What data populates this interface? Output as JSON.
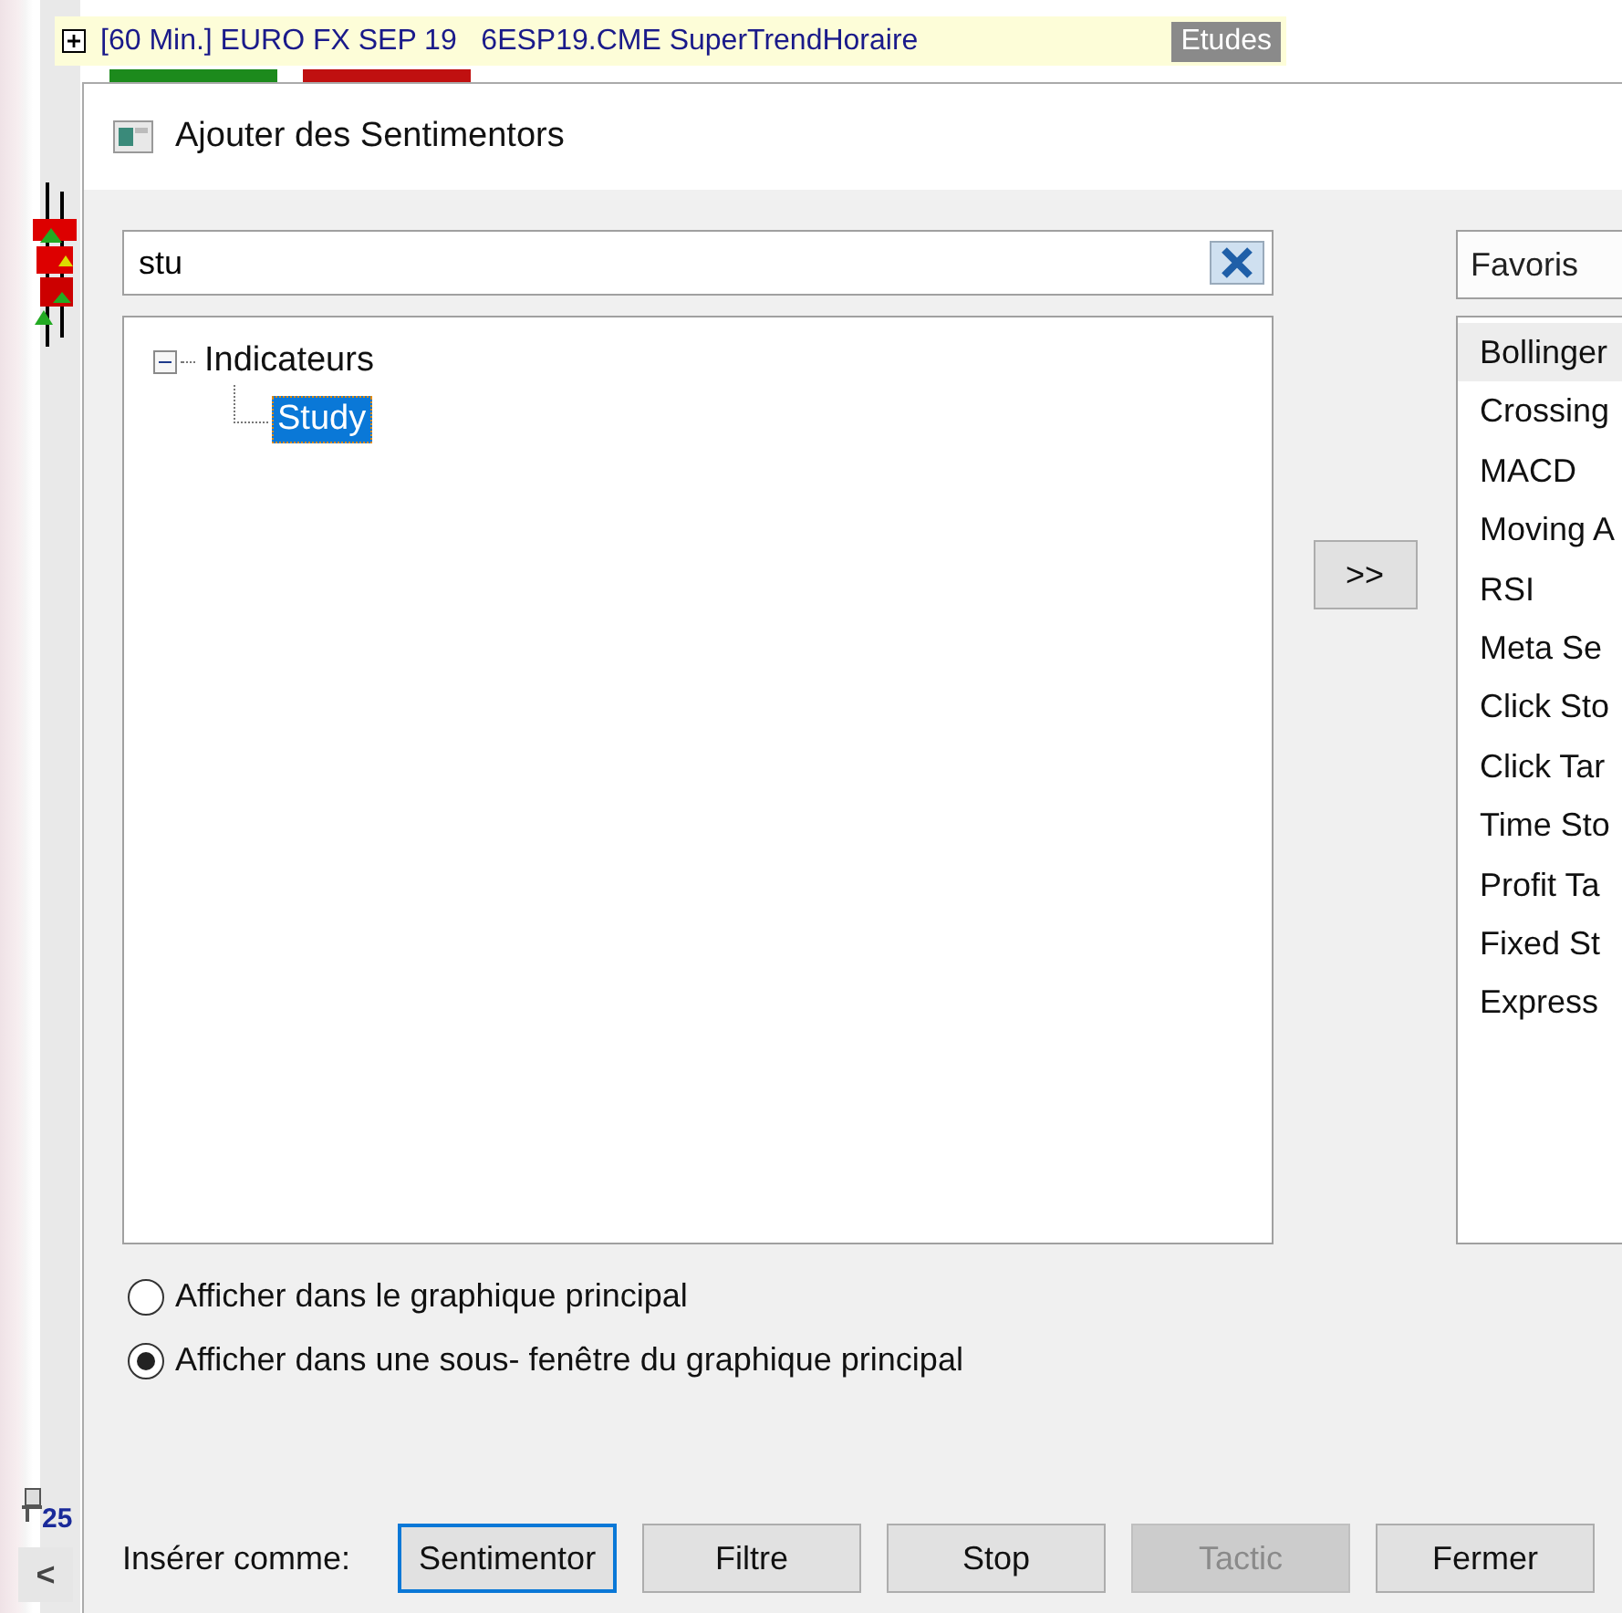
{
  "chart": {
    "header": {
      "title": "[60 Min.] EURO FX SEP 19   6ESP19.CME SuperTrendHoraire",
      "badge": "Etudes"
    },
    "axis_label": "25",
    "scroll_button": "<"
  },
  "dialog": {
    "title": "Ajouter des Sentimentors",
    "search": {
      "value": "stu"
    },
    "tree": [
      {
        "label": "Indicateurs",
        "expanded": true,
        "selected": false,
        "children": [
          {
            "label": "Study",
            "selected": true
          }
        ]
      }
    ],
    "move_button": ">>",
    "favorites": {
      "header": "Favoris",
      "items": [
        {
          "label": "Bollinger",
          "selected": true
        },
        {
          "label": "Crossing",
          "selected": false
        },
        {
          "label": "MACD",
          "selected": false
        },
        {
          "label": "Moving A",
          "selected": false
        },
        {
          "label": "RSI",
          "selected": false
        },
        {
          "label": "Meta Se",
          "selected": false
        },
        {
          "label": "Click Sto",
          "selected": false
        },
        {
          "label": "Click Tar",
          "selected": false
        },
        {
          "label": "Time Sto",
          "selected": false
        },
        {
          "label": "Profit Ta",
          "selected": false
        },
        {
          "label": "Fixed St",
          "selected": false
        },
        {
          "label": "Express",
          "selected": false
        }
      ]
    },
    "display_options": [
      {
        "label": "Afficher dans le graphique principal",
        "selected": false
      },
      {
        "label": "Afficher dans une sous- fenêtre du graphique principal",
        "selected": true
      }
    ],
    "insert_label": "Insérer comme:",
    "buttons": [
      {
        "label": "Sentimentor",
        "focused": true,
        "disabled": false
      },
      {
        "label": "Filtre",
        "focused": false,
        "disabled": false
      },
      {
        "label": "Stop",
        "focused": false,
        "disabled": false
      },
      {
        "label": "Tactic",
        "focused": false,
        "disabled": true
      },
      {
        "label": "Fermer",
        "focused": false,
        "disabled": false
      }
    ]
  }
}
